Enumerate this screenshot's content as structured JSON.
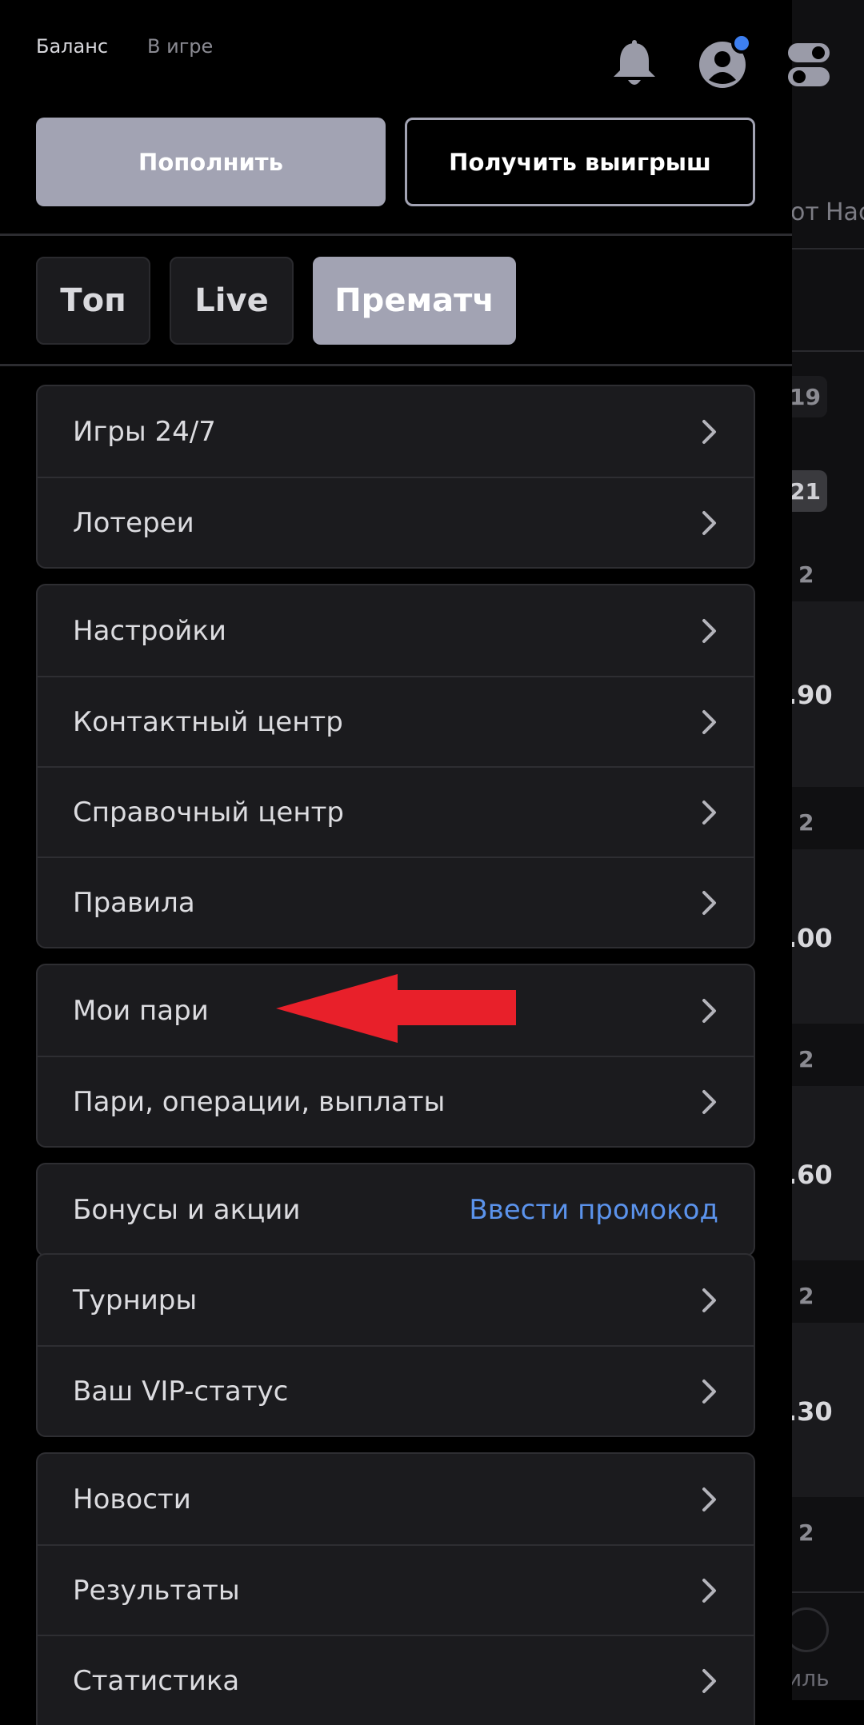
{
  "header": {
    "tabs": [
      {
        "label": "Баланс",
        "active": true
      },
      {
        "label": "В игре",
        "active": false
      }
    ],
    "icons": [
      "bell-icon",
      "user-avatar-icon",
      "settings-toggle-icon"
    ],
    "notification_color": "#3d7ff0"
  },
  "actions": {
    "deposit_label": "Пополнить",
    "withdraw_label": "Получить выигрыш"
  },
  "mode_tabs": [
    {
      "label": "Топ",
      "active": false
    },
    {
      "label": "Live",
      "active": false
    },
    {
      "label": "Прематч",
      "active": true
    }
  ],
  "groups": [
    {
      "items": [
        {
          "label": "Игры 24/7"
        },
        {
          "label": "Лотереи"
        }
      ]
    },
    {
      "items": [
        {
          "label": "Настройки"
        },
        {
          "label": "Контактный центр"
        },
        {
          "label": "Справочный центр"
        },
        {
          "label": "Правила"
        }
      ]
    },
    {
      "items": [
        {
          "label": "Мои пари"
        },
        {
          "label": "Пари, операции, выплаты"
        }
      ]
    },
    {
      "items": [
        {
          "label": "Бонусы и акции",
          "action": "Ввести промокод"
        }
      ]
    },
    {
      "items": [
        {
          "label": "Турниры"
        },
        {
          "label": "Ваш VIP-статус"
        }
      ]
    },
    {
      "items": [
        {
          "label": "Новости"
        },
        {
          "label": "Результаты"
        },
        {
          "label": "Статистика"
        }
      ]
    }
  ],
  "background": {
    "tab_partial_1": "от",
    "tab_partial_2": "Нас",
    "chip_1": "19",
    "chip_2": "21",
    "twos": [
      "2",
      "2",
      "2",
      "2",
      "2"
    ],
    "odds": [
      ".90",
      ".00",
      ".60",
      ".30"
    ],
    "bottom_label": "иль"
  },
  "colors": {
    "accent_button": "#a2a3b3",
    "promo_link": "#5b93ec",
    "arrow": "#e8202a"
  }
}
